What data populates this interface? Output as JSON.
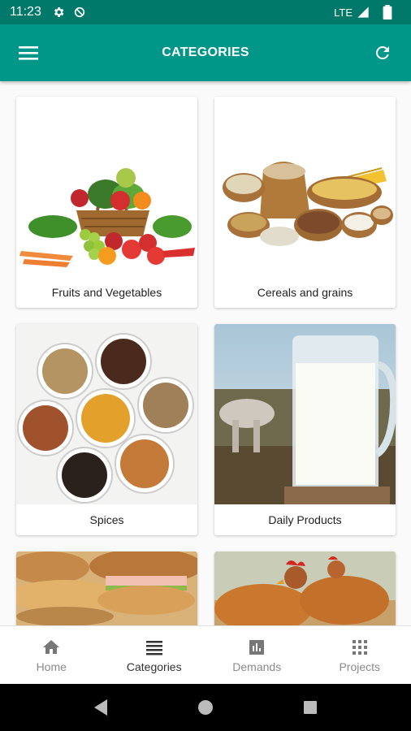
{
  "status_bar": {
    "time": "11:23",
    "network": "LTE"
  },
  "app_bar": {
    "title": "CATEGORIES"
  },
  "categories": [
    {
      "label": "Fruits and Vegetables"
    },
    {
      "label": "Cereals and grains"
    },
    {
      "label": "Spices"
    },
    {
      "label": "Daily Products"
    },
    {
      "label": ""
    },
    {
      "label": ""
    }
  ],
  "bottom_nav": [
    {
      "label": "Home",
      "icon": "home-icon"
    },
    {
      "label": "Categories",
      "icon": "list-icon",
      "active": true
    },
    {
      "label": "Demands",
      "icon": "bar-chart-icon"
    },
    {
      "label": "Projects",
      "icon": "grid-apps-icon"
    }
  ],
  "colors": {
    "primary": "#009688",
    "primary_dark": "#00796b"
  }
}
